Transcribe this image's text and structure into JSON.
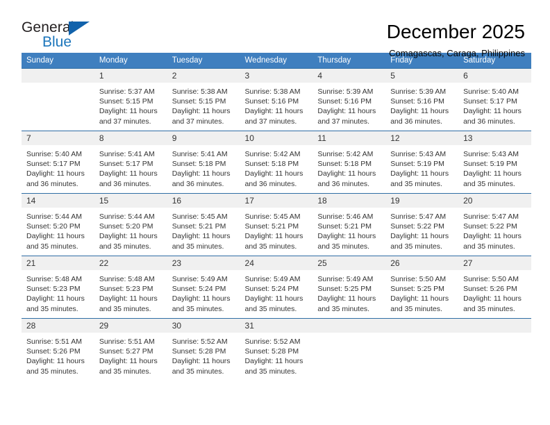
{
  "brand": {
    "word_one": "General",
    "word_two": "Blue",
    "triangle_icon": "triangle-icon",
    "colors": {
      "general": "#231f20",
      "blue": "#1b75bb",
      "triangle": "#1162ab"
    }
  },
  "header": {
    "title": "December 2025",
    "subtitle": "Comagascas, Caraga, Philippines"
  },
  "theme": {
    "header_row_bg": "#3f7fbf",
    "row_divider": "#2e6da4",
    "daynum_bg": "#f0f0f0",
    "text": "#333333"
  },
  "weekdays": [
    "Sunday",
    "Monday",
    "Tuesday",
    "Wednesday",
    "Thursday",
    "Friday",
    "Saturday"
  ],
  "weeks": [
    [
      {
        "day": "",
        "sunrise": "",
        "sunset": "",
        "daylight_line1": "",
        "daylight_line2": ""
      },
      {
        "day": "1",
        "sunrise": "Sunrise: 5:37 AM",
        "sunset": "Sunset: 5:15 PM",
        "daylight_line1": "Daylight: 11 hours",
        "daylight_line2": "and 37 minutes."
      },
      {
        "day": "2",
        "sunrise": "Sunrise: 5:38 AM",
        "sunset": "Sunset: 5:15 PM",
        "daylight_line1": "Daylight: 11 hours",
        "daylight_line2": "and 37 minutes."
      },
      {
        "day": "3",
        "sunrise": "Sunrise: 5:38 AM",
        "sunset": "Sunset: 5:16 PM",
        "daylight_line1": "Daylight: 11 hours",
        "daylight_line2": "and 37 minutes."
      },
      {
        "day": "4",
        "sunrise": "Sunrise: 5:39 AM",
        "sunset": "Sunset: 5:16 PM",
        "daylight_line1": "Daylight: 11 hours",
        "daylight_line2": "and 37 minutes."
      },
      {
        "day": "5",
        "sunrise": "Sunrise: 5:39 AM",
        "sunset": "Sunset: 5:16 PM",
        "daylight_line1": "Daylight: 11 hours",
        "daylight_line2": "and 36 minutes."
      },
      {
        "day": "6",
        "sunrise": "Sunrise: 5:40 AM",
        "sunset": "Sunset: 5:17 PM",
        "daylight_line1": "Daylight: 11 hours",
        "daylight_line2": "and 36 minutes."
      }
    ],
    [
      {
        "day": "7",
        "sunrise": "Sunrise: 5:40 AM",
        "sunset": "Sunset: 5:17 PM",
        "daylight_line1": "Daylight: 11 hours",
        "daylight_line2": "and 36 minutes."
      },
      {
        "day": "8",
        "sunrise": "Sunrise: 5:41 AM",
        "sunset": "Sunset: 5:17 PM",
        "daylight_line1": "Daylight: 11 hours",
        "daylight_line2": "and 36 minutes."
      },
      {
        "day": "9",
        "sunrise": "Sunrise: 5:41 AM",
        "sunset": "Sunset: 5:18 PM",
        "daylight_line1": "Daylight: 11 hours",
        "daylight_line2": "and 36 minutes."
      },
      {
        "day": "10",
        "sunrise": "Sunrise: 5:42 AM",
        "sunset": "Sunset: 5:18 PM",
        "daylight_line1": "Daylight: 11 hours",
        "daylight_line2": "and 36 minutes."
      },
      {
        "day": "11",
        "sunrise": "Sunrise: 5:42 AM",
        "sunset": "Sunset: 5:18 PM",
        "daylight_line1": "Daylight: 11 hours",
        "daylight_line2": "and 36 minutes."
      },
      {
        "day": "12",
        "sunrise": "Sunrise: 5:43 AM",
        "sunset": "Sunset: 5:19 PM",
        "daylight_line1": "Daylight: 11 hours",
        "daylight_line2": "and 35 minutes."
      },
      {
        "day": "13",
        "sunrise": "Sunrise: 5:43 AM",
        "sunset": "Sunset: 5:19 PM",
        "daylight_line1": "Daylight: 11 hours",
        "daylight_line2": "and 35 minutes."
      }
    ],
    [
      {
        "day": "14",
        "sunrise": "Sunrise: 5:44 AM",
        "sunset": "Sunset: 5:20 PM",
        "daylight_line1": "Daylight: 11 hours",
        "daylight_line2": "and 35 minutes."
      },
      {
        "day": "15",
        "sunrise": "Sunrise: 5:44 AM",
        "sunset": "Sunset: 5:20 PM",
        "daylight_line1": "Daylight: 11 hours",
        "daylight_line2": "and 35 minutes."
      },
      {
        "day": "16",
        "sunrise": "Sunrise: 5:45 AM",
        "sunset": "Sunset: 5:21 PM",
        "daylight_line1": "Daylight: 11 hours",
        "daylight_line2": "and 35 minutes."
      },
      {
        "day": "17",
        "sunrise": "Sunrise: 5:45 AM",
        "sunset": "Sunset: 5:21 PM",
        "daylight_line1": "Daylight: 11 hours",
        "daylight_line2": "and 35 minutes."
      },
      {
        "day": "18",
        "sunrise": "Sunrise: 5:46 AM",
        "sunset": "Sunset: 5:21 PM",
        "daylight_line1": "Daylight: 11 hours",
        "daylight_line2": "and 35 minutes."
      },
      {
        "day": "19",
        "sunrise": "Sunrise: 5:47 AM",
        "sunset": "Sunset: 5:22 PM",
        "daylight_line1": "Daylight: 11 hours",
        "daylight_line2": "and 35 minutes."
      },
      {
        "day": "20",
        "sunrise": "Sunrise: 5:47 AM",
        "sunset": "Sunset: 5:22 PM",
        "daylight_line1": "Daylight: 11 hours",
        "daylight_line2": "and 35 minutes."
      }
    ],
    [
      {
        "day": "21",
        "sunrise": "Sunrise: 5:48 AM",
        "sunset": "Sunset: 5:23 PM",
        "daylight_line1": "Daylight: 11 hours",
        "daylight_line2": "and 35 minutes."
      },
      {
        "day": "22",
        "sunrise": "Sunrise: 5:48 AM",
        "sunset": "Sunset: 5:23 PM",
        "daylight_line1": "Daylight: 11 hours",
        "daylight_line2": "and 35 minutes."
      },
      {
        "day": "23",
        "sunrise": "Sunrise: 5:49 AM",
        "sunset": "Sunset: 5:24 PM",
        "daylight_line1": "Daylight: 11 hours",
        "daylight_line2": "and 35 minutes."
      },
      {
        "day": "24",
        "sunrise": "Sunrise: 5:49 AM",
        "sunset": "Sunset: 5:24 PM",
        "daylight_line1": "Daylight: 11 hours",
        "daylight_line2": "and 35 minutes."
      },
      {
        "day": "25",
        "sunrise": "Sunrise: 5:49 AM",
        "sunset": "Sunset: 5:25 PM",
        "daylight_line1": "Daylight: 11 hours",
        "daylight_line2": "and 35 minutes."
      },
      {
        "day": "26",
        "sunrise": "Sunrise: 5:50 AM",
        "sunset": "Sunset: 5:25 PM",
        "daylight_line1": "Daylight: 11 hours",
        "daylight_line2": "and 35 minutes."
      },
      {
        "day": "27",
        "sunrise": "Sunrise: 5:50 AM",
        "sunset": "Sunset: 5:26 PM",
        "daylight_line1": "Daylight: 11 hours",
        "daylight_line2": "and 35 minutes."
      }
    ],
    [
      {
        "day": "28",
        "sunrise": "Sunrise: 5:51 AM",
        "sunset": "Sunset: 5:26 PM",
        "daylight_line1": "Daylight: 11 hours",
        "daylight_line2": "and 35 minutes."
      },
      {
        "day": "29",
        "sunrise": "Sunrise: 5:51 AM",
        "sunset": "Sunset: 5:27 PM",
        "daylight_line1": "Daylight: 11 hours",
        "daylight_line2": "and 35 minutes."
      },
      {
        "day": "30",
        "sunrise": "Sunrise: 5:52 AM",
        "sunset": "Sunset: 5:28 PM",
        "daylight_line1": "Daylight: 11 hours",
        "daylight_line2": "and 35 minutes."
      },
      {
        "day": "31",
        "sunrise": "Sunrise: 5:52 AM",
        "sunset": "Sunset: 5:28 PM",
        "daylight_line1": "Daylight: 11 hours",
        "daylight_line2": "and 35 minutes."
      },
      {
        "day": "",
        "sunrise": "",
        "sunset": "",
        "daylight_line1": "",
        "daylight_line2": ""
      },
      {
        "day": "",
        "sunrise": "",
        "sunset": "",
        "daylight_line1": "",
        "daylight_line2": ""
      },
      {
        "day": "",
        "sunrise": "",
        "sunset": "",
        "daylight_line1": "",
        "daylight_line2": ""
      }
    ]
  ]
}
